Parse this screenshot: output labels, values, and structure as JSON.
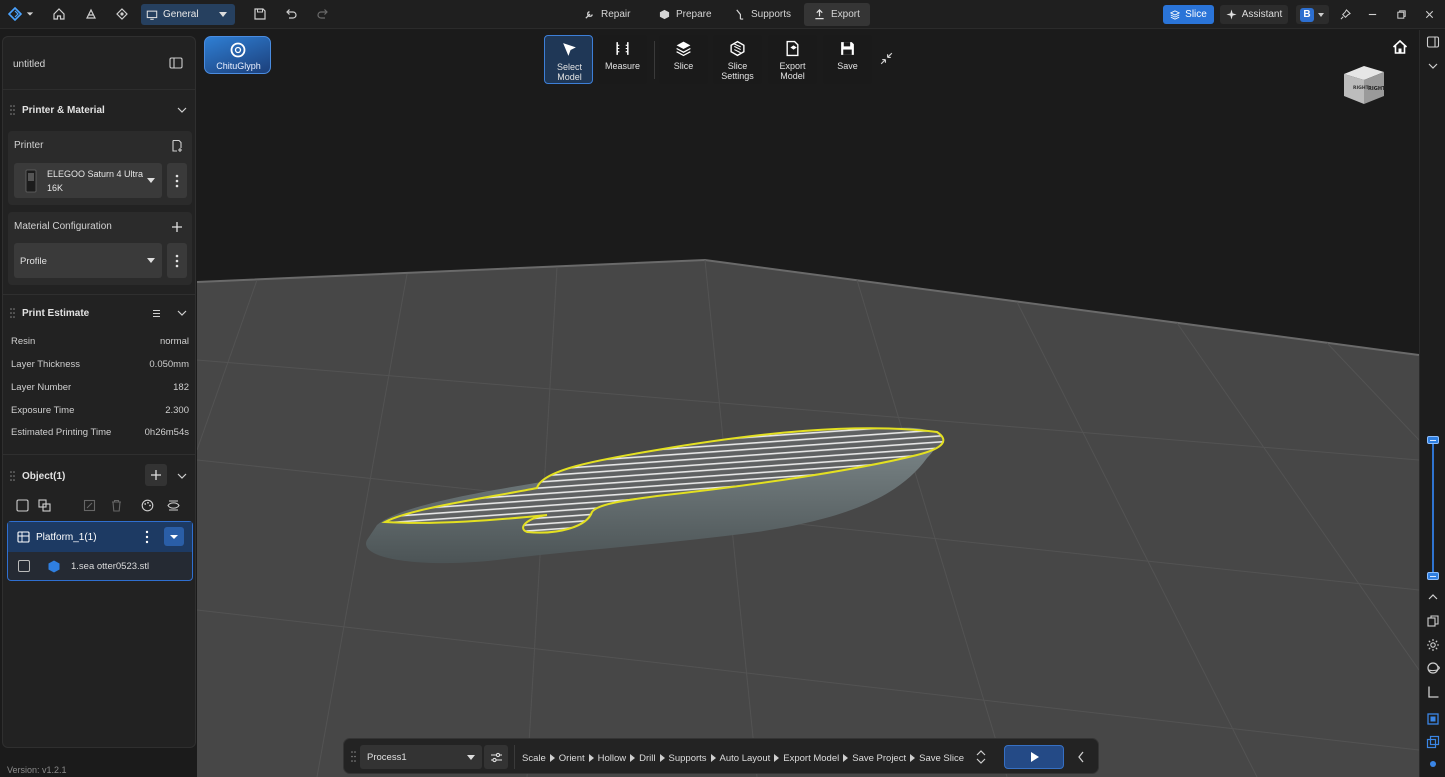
{
  "app": {
    "workspace_label": "General",
    "version": "Version: v1.2.1"
  },
  "stages": [
    {
      "label": "Repair",
      "icon": "wrench-icon"
    },
    {
      "label": "Prepare",
      "icon": "cube-icon"
    },
    {
      "label": "Supports",
      "icon": "support-icon"
    },
    {
      "label": "Export",
      "icon": "export-icon",
      "active": true
    }
  ],
  "topright": {
    "slice_label": "Slice",
    "assistant_label": "Assistant",
    "account_letter": "B"
  },
  "left_panel": {
    "project_title": "untitled",
    "printer_material": {
      "title": "Printer & Material",
      "printer_label": "Printer",
      "printer_name": "ELEGOO Saturn 4 Ultra",
      "printer_name_2": "16K",
      "material_label": "Material Configuration",
      "profile_value": "Profile"
    },
    "print_estimate": {
      "title": "Print Estimate",
      "rows": [
        {
          "key": "Resin",
          "value": "normal"
        },
        {
          "key": "Layer Thickness",
          "value": "0.050mm"
        },
        {
          "key": "Layer Number",
          "value": "182"
        },
        {
          "key": "Exposure Time",
          "value": "2.300"
        },
        {
          "key": "Estimated Printing Time",
          "value": "0h26m54s"
        }
      ]
    },
    "objects": {
      "title": "Object(1)",
      "platform_label": "Platform_1(1)",
      "file_name": "1.sea otter0523.stl"
    }
  },
  "viewport": {
    "chitu_label": "ChituGlyph",
    "tools": [
      {
        "label_1": "Select",
        "label_2": "Model",
        "icon": "select-arrow-icon",
        "active": true
      },
      {
        "label_1": "Measure",
        "label_2": "",
        "icon": "measure-icon"
      },
      {
        "label_1": "Slice",
        "label_2": "",
        "icon": "layers-icon"
      },
      {
        "label_1": "Slice",
        "label_2": "Settings",
        "icon": "slice-settings-icon"
      },
      {
        "label_1": "Export",
        "label_2": "Model",
        "icon": "export-model-icon"
      },
      {
        "label_1": "Save",
        "label_2": "",
        "icon": "save-icon"
      }
    ],
    "viewcube_label": "RIGHT",
    "layer_slider": {
      "top_fraction": 0.0,
      "bottom_fraction": 1.0
    },
    "colors": {
      "accent": "#2a74d8",
      "outline": "#d9d92a",
      "floor": "#474747",
      "background": "#1b1b1b"
    }
  },
  "process_bar": {
    "process_value": "Process1",
    "steps": [
      "Scale",
      "Orient",
      "Hollow",
      "Drill",
      "Supports",
      "Auto Layout",
      "Export Model",
      "Save Project",
      "Save Slice"
    ]
  }
}
